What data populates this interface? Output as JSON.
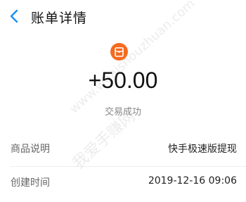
{
  "header": {
    "title": "账单详情",
    "back_icon": "chevron-left-icon",
    "accent": "#1a8ef0"
  },
  "transaction": {
    "icon": "red-packet-icon",
    "icon_color": "#f56a1f",
    "amount": "+50.00",
    "status": "交易成功"
  },
  "details": [
    {
      "label": "商品说明",
      "value": "快手极速版提现"
    },
    {
      "label": "创建时间",
      "value": "2019-12-16 09:06"
    }
  ],
  "watermark": {
    "line1": "www.woaishouzhuan.com",
    "line2": "我爱手赚网"
  }
}
